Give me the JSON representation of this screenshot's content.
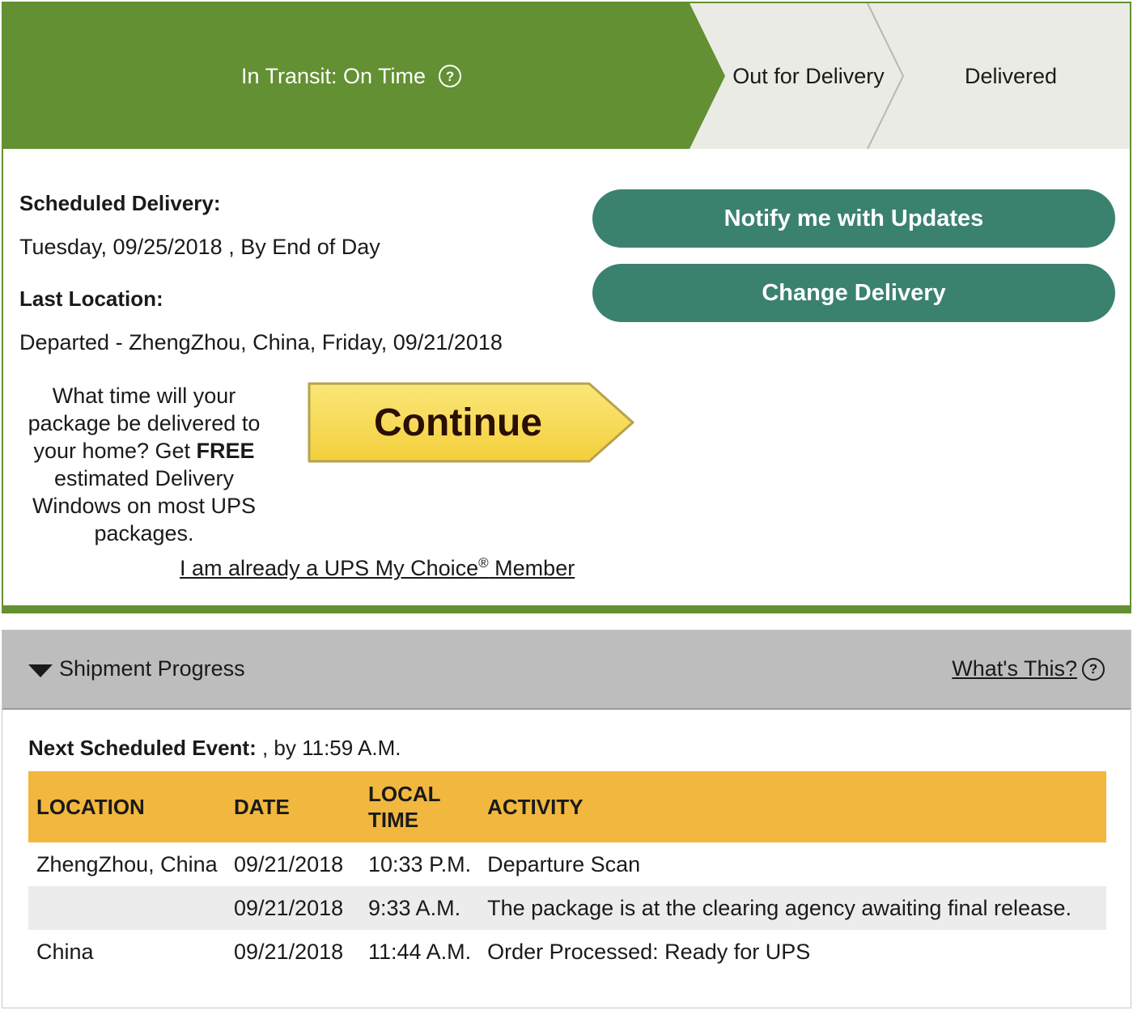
{
  "status": {
    "current_step": "In Transit: On Time",
    "step_out_for_delivery": "Out for Delivery",
    "step_delivered": "Delivered",
    "help_glyph": "?"
  },
  "colors": {
    "brand_green": "#629032",
    "button_teal": "#3a826d",
    "step_inactive": "#ebebe5",
    "continue_yellow": "#f8dd5a",
    "table_header": "#f2b73e"
  },
  "delivery": {
    "scheduled_label": "Scheduled Delivery:",
    "scheduled_value": "Tuesday, 09/25/2018 , By End of Day",
    "last_location_label": "Last Location:",
    "last_location_value": "Departed - ZhengZhou, China, Friday, 09/21/2018"
  },
  "actions": {
    "notify_label": "Notify me with Updates",
    "change_label": "Change Delivery"
  },
  "promo": {
    "text_before": "What time will your package be delivered to your home? Get ",
    "text_bold": "FREE",
    "text_after": " estimated Delivery Windows on most UPS packages.",
    "continue_label": "Continue",
    "member_link_prefix": "I am already a UPS My Choice",
    "member_link_reg": "®",
    "member_link_suffix": " Member"
  },
  "progress": {
    "title": "Shipment Progress",
    "whats_this": "What's This?",
    "next_event_label": "Next Scheduled Event:",
    "next_event_value": " , by 11:59 A.M.",
    "columns": {
      "location": "LOCATION",
      "date": "DATE",
      "local_time_1": "LOCAL",
      "local_time_2": "TIME",
      "activity": "ACTIVITY"
    },
    "rows": [
      {
        "location": "ZhengZhou,  China",
        "date": "09/21/2018",
        "time": "10:33 P.M.",
        "activity": "Departure Scan"
      },
      {
        "location": "",
        "date": "09/21/2018",
        "time": "9:33 A.M.",
        "activity": "The package is at the clearing agency awaiting final release."
      },
      {
        "location": "China",
        "date": "09/21/2018",
        "time": "11:44 A.M.",
        "activity": "Order Processed: Ready for UPS"
      }
    ]
  }
}
